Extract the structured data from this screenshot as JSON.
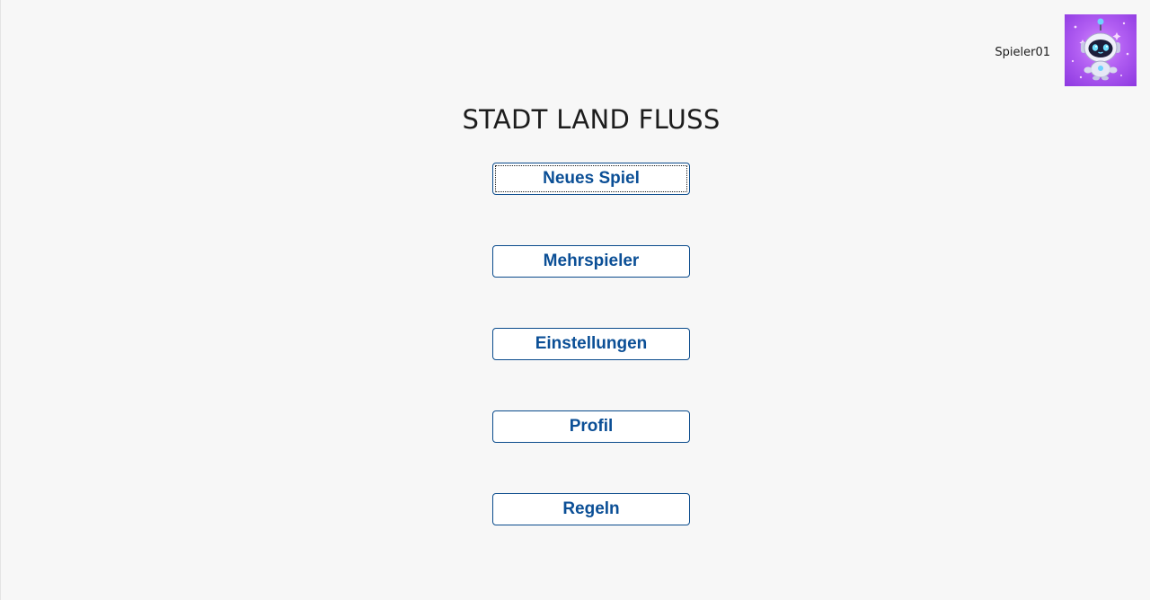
{
  "header": {
    "username": "Spieler01",
    "avatar_icon": "robot-avatar-icon"
  },
  "main": {
    "title": "STADT LAND FLUSS",
    "menu": [
      {
        "label": "Neues Spiel",
        "focused": true
      },
      {
        "label": "Mehrspieler",
        "focused": false
      },
      {
        "label": "Einstellungen",
        "focused": false
      },
      {
        "label": "Profil",
        "focused": false
      },
      {
        "label": "Regeln",
        "focused": false
      }
    ]
  },
  "colors": {
    "background": "#f7f7f7",
    "button_text": "#0b4f96",
    "button_border": "#0a4b8c",
    "avatar_bg": "#b15ef2"
  }
}
